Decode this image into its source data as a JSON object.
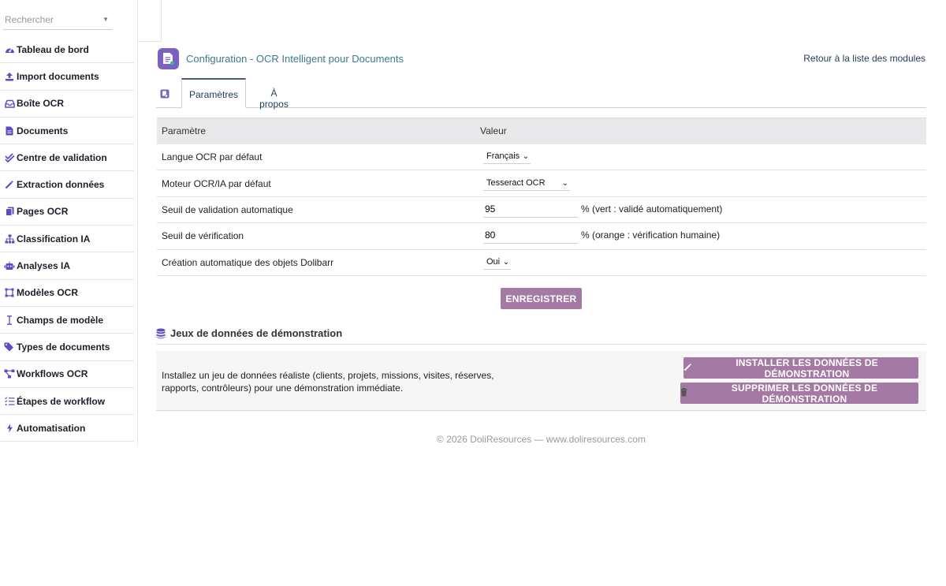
{
  "search": {
    "placeholder": "Rechercher"
  },
  "sidebar": {
    "items": [
      {
        "label": "Tableau de bord",
        "icon": "dashboard-icon"
      },
      {
        "label": "Import documents",
        "icon": "upload-icon"
      },
      {
        "label": "Boîte OCR",
        "icon": "inbox-icon"
      },
      {
        "label": "Documents",
        "icon": "file-icon"
      },
      {
        "label": "Centre de validation",
        "icon": "check-double-icon"
      },
      {
        "label": "Extraction données",
        "icon": "magic-wand-icon"
      },
      {
        "label": "Pages OCR",
        "icon": "copy-icon"
      },
      {
        "label": "Classification IA",
        "icon": "sitemap-icon"
      },
      {
        "label": "Analyses IA",
        "icon": "robot-icon"
      },
      {
        "label": "Modèles OCR",
        "icon": "vector-square-icon"
      },
      {
        "label": "Champs de modèle",
        "icon": "i-cursor-icon"
      },
      {
        "label": "Types de documents",
        "icon": "tags-icon"
      },
      {
        "label": "Workflows OCR",
        "icon": "project-diagram-icon"
      },
      {
        "label": "Étapes de workflow",
        "icon": "list-check-icon"
      },
      {
        "label": "Automatisation",
        "icon": "bolt-icon"
      }
    ]
  },
  "header": {
    "title": "Configuration - OCR Intelligent pour Documents",
    "back_link": "Retour à la liste des modules"
  },
  "tabs": [
    {
      "label": "Paramètres",
      "active": true
    },
    {
      "label": "À propos",
      "active": false
    }
  ],
  "table": {
    "col_param": "Paramètre",
    "col_value": "Valeur",
    "rows": [
      {
        "label": "Langue OCR par défaut",
        "value": "Français"
      },
      {
        "label": "Moteur OCR/IA par défaut",
        "value": "Tesseract OCR"
      },
      {
        "label": "Seuil de validation automatique",
        "value": "95",
        "hint": "% (vert : validé automatiquement)"
      },
      {
        "label": "Seuil de vérification",
        "value": "80",
        "hint": "% (orange : vérification humaine)"
      },
      {
        "label": "Création automatique des objets Dolibarr",
        "value": "Oui"
      }
    ]
  },
  "save_label": "ENREGISTRER",
  "demo": {
    "title": "Jeux de données de démonstration",
    "description": "Installez un jeu de données réaliste (clients, projets, missions, visites, réserves, rapports, contrôleurs) pour une démonstration immédiate.",
    "install_label": "INSTALLER LES DONNÉES DE DÉMONSTRATION",
    "delete_label": "SUPPRIMER LES DONNÉES DE DÉMONSTRATION"
  },
  "footer": "© 2026 DoliResources — www.doliresources.com",
  "colors": {
    "accent": "#7b61c4",
    "button": "#a47aa5",
    "title": "#3b7a8f",
    "link": "#263c5c"
  }
}
